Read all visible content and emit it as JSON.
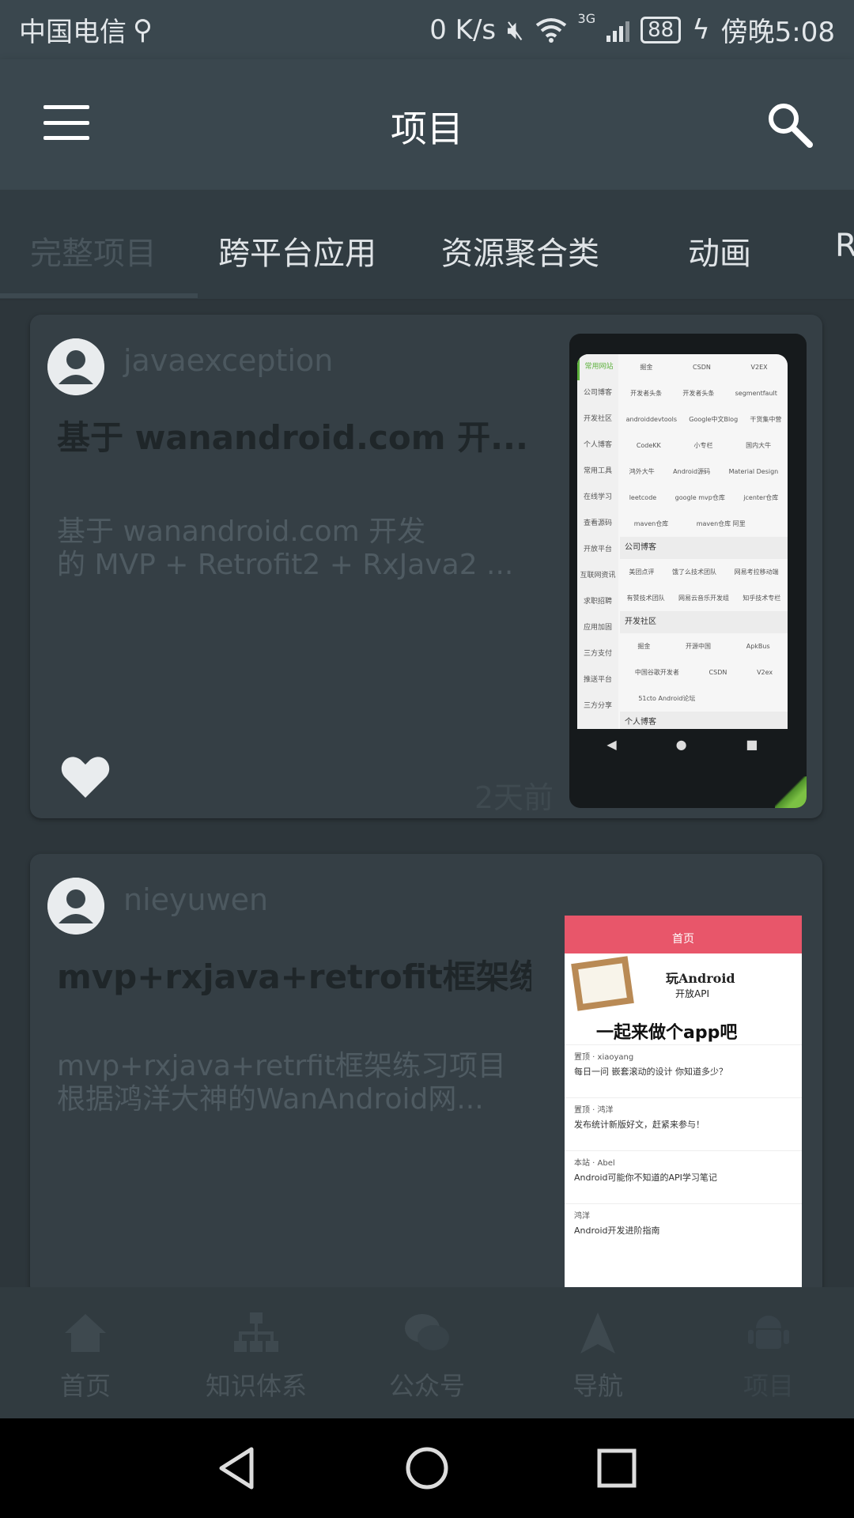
{
  "status_bar": {
    "carrier": "中国电信",
    "speed": "0 K/s",
    "network": "3G",
    "battery": "88",
    "time": "傍晚5:08"
  },
  "app_bar": {
    "title": "项目"
  },
  "tabs": [
    "完整项目",
    "跨平台应用",
    "资源聚合类",
    "动画",
    "R"
  ],
  "articles": [
    {
      "author": "javaexception",
      "title": "基于 wanandroid.com 开...",
      "desc_line1": "基于 wanandroid.com 开发",
      "desc_line2": "的 MVP + Retrofit2 + RxJava2 ...",
      "time": "2天前",
      "thumb": {
        "side_menu": [
          "常用网站",
          "公司博客",
          "开发社区",
          "个人博客",
          "常用工具",
          "在线学习",
          "查看源码",
          "开放平台",
          "互联网资讯",
          "求职招聘",
          "应用加固",
          "三方支付",
          "推送平台",
          "三方分享"
        ],
        "rows": [
          [
            "掘金",
            "CSDN",
            "V2EX"
          ],
          [
            "开发者头条",
            "开发者头条",
            "segmentfault"
          ],
          [
            "androiddevtools",
            "Google中文Blog",
            "干货集中营"
          ],
          [
            "CodeKK",
            "小专栏",
            "国内大牛"
          ],
          [
            "鸿外大牛",
            "Android源码",
            "Material Design"
          ],
          [
            "leetcode",
            "google mvp仓库",
            "jcenter仓库"
          ],
          [
            "maven仓库",
            "maven仓库 阿里",
            ""
          ]
        ],
        "section1": "公司博客",
        "rows2": [
          [
            "美团点评",
            "饿了么技术团队",
            "网易考拉移动端"
          ],
          [
            "有赞技术团队",
            "网易云音乐开发组",
            "知乎技术专栏"
          ]
        ],
        "section2": "开发社区",
        "rows3": [
          [
            "掘金",
            "开源中国",
            "ApkBus"
          ],
          [
            "中国谷歌开发者",
            "CSDN",
            "V2ex"
          ],
          [
            "51cto Android论坛",
            "",
            ""
          ]
        ],
        "section3": "个人博客"
      }
    },
    {
      "author": "nieyuwen",
      "title": "mvp+rxjava+retrofit框架练...",
      "desc_line1": "mvp+rxjava+retrfit框架练习项目",
      "desc_line2": "根据鸿洋大神的WanAndroid网...",
      "thumb": {
        "header": "首页",
        "banner_line1": "玩Android",
        "banner_line2": "开放API",
        "banner_line3": "一起来做个app吧",
        "items": [
          {
            "meta": "置顶 · xiaoyang",
            "title": "每日一问 嵌套滚动的设计 你知道多少？"
          },
          {
            "meta": "置顶 · 鸿洋",
            "title": "发布统计新版好文，赶紧来参与！"
          },
          {
            "meta": "本站 · Abel",
            "title": "Android可能你不知道的API学习笔记"
          },
          {
            "meta": "鸿洋",
            "title": "Android开发进阶指南"
          }
        ]
      }
    }
  ],
  "bottom_nav": [
    "首页",
    "知识体系",
    "公众号",
    "导航",
    "项目"
  ]
}
